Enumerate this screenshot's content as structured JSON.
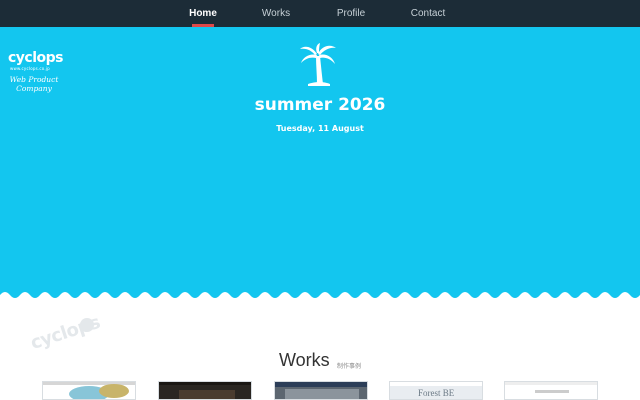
{
  "nav": {
    "items": [
      {
        "label": "Home",
        "active": true
      },
      {
        "label": "Works",
        "active": false
      },
      {
        "label": "Profile",
        "active": false
      },
      {
        "label": "Contact",
        "active": false
      }
    ]
  },
  "brand": {
    "name": "cyclops",
    "url": "www.cyclops.co.jp",
    "tagline": "Web Product Company"
  },
  "hero": {
    "icon": "palm-tree-icon",
    "season": "summer 2026",
    "date": "Tuesday, 11 August"
  },
  "watermark": {
    "text": "cyclops"
  },
  "works": {
    "title": "Works",
    "subtitle": "制作事例",
    "thumbnails": [
      {
        "name": "work-thumbnail-1"
      },
      {
        "name": "work-thumbnail-2"
      },
      {
        "name": "work-thumbnail-3"
      },
      {
        "name": "work-thumbnail-4",
        "text": "Forest BE"
      },
      {
        "name": "work-thumbnail-5"
      }
    ]
  },
  "colors": {
    "nav_bg": "#1c2c37",
    "hero_bg": "#13c6ef",
    "active_indicator": "#e04848"
  }
}
